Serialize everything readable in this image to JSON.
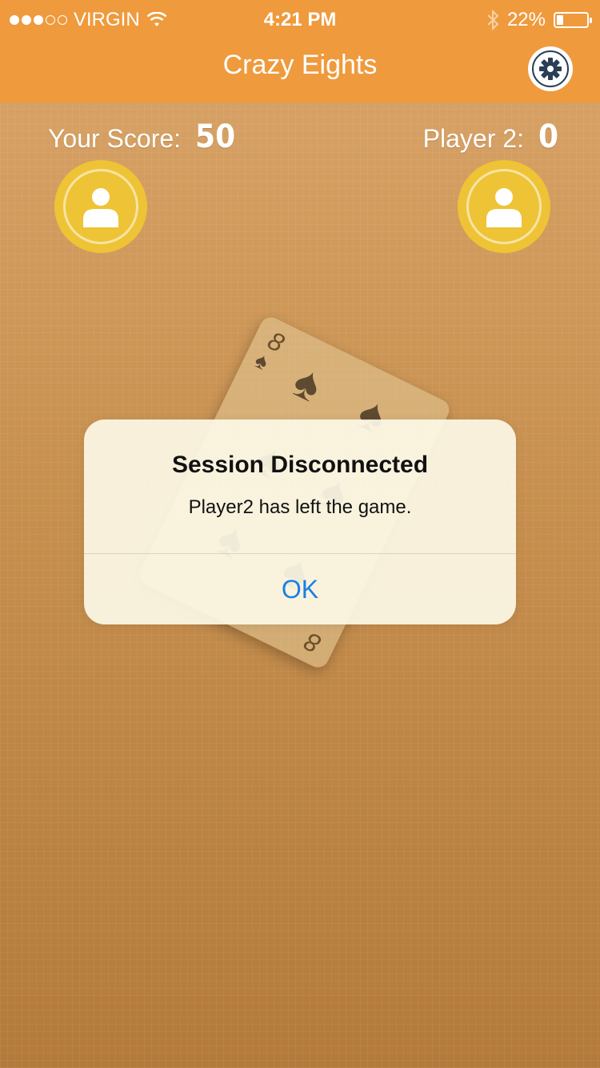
{
  "status_bar": {
    "carrier": "VIRGIN",
    "time": "4:21 PM",
    "battery_text": "22%",
    "battery_level": 0.22,
    "signal_filled": 3,
    "signal_total": 5
  },
  "nav": {
    "title": "Crazy Eights",
    "settings_icon": "gear-icon"
  },
  "scores": {
    "left_label": "Your Score:",
    "left_value": "50",
    "right_label": "Player 2:",
    "right_value": "0"
  },
  "card": {
    "rank": "8",
    "suit": "spade"
  },
  "dialog": {
    "title": "Session Disconnected",
    "message": "Player2 has left the game.",
    "ok_label": "OK"
  },
  "colors": {
    "nav_bg": "#ef9a3c",
    "avatar": "#eec335",
    "link": "#1a80e6"
  }
}
